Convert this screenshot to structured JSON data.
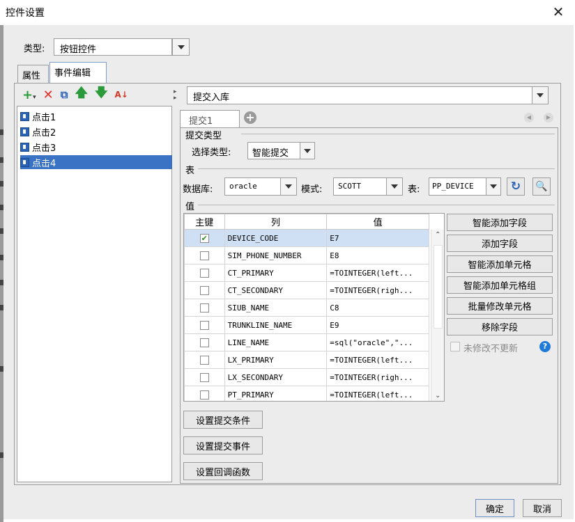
{
  "window": {
    "title": "控件设置"
  },
  "type_row": {
    "label": "类型:",
    "value": "按钮控件"
  },
  "tabs": [
    {
      "label": "属性"
    },
    {
      "label": "事件编辑"
    }
  ],
  "event_tree": {
    "items": [
      {
        "label": "点击1"
      },
      {
        "label": "点击2"
      },
      {
        "label": "点击3"
      },
      {
        "label": "点击4"
      }
    ]
  },
  "action": {
    "value": "提交入库"
  },
  "sub_tabs": [
    {
      "label": "提交1"
    }
  ],
  "submit_type": {
    "section": "提交类型",
    "label": "选择类型:",
    "value": "智能提交"
  },
  "table_section": {
    "section": "表",
    "db_label": "数据库:",
    "db_value": "oracle",
    "mode_label": "模式:",
    "mode_value": "SCOTT",
    "table_label": "表:",
    "table_value": "PP_DEVICE"
  },
  "values_section": {
    "section": "值",
    "headers": {
      "key": "主键",
      "col": "列",
      "val": "值"
    },
    "rows": [
      {
        "checked": true,
        "col": "DEVICE_CODE",
        "val": "E7"
      },
      {
        "checked": false,
        "col": "SIM_PHONE_NUMBER",
        "val": "E8"
      },
      {
        "checked": false,
        "col": "CT_PRIMARY",
        "val": "=TOINTEGER(left..."
      },
      {
        "checked": false,
        "col": "CT_SECONDARY",
        "val": "=TOINTEGER(righ..."
      },
      {
        "checked": false,
        "col": "SIUB_NAME",
        "val": "C8"
      },
      {
        "checked": false,
        "col": "TRUNKLINE_NAME",
        "val": "E9"
      },
      {
        "checked": false,
        "col": "LINE_NAME",
        "val": "=sql(\"oracle\",\"..."
      },
      {
        "checked": false,
        "col": "LX_PRIMARY",
        "val": "=TOINTEGER(left..."
      },
      {
        "checked": false,
        "col": "LX_SECONDARY",
        "val": "=TOINTEGER(righ..."
      },
      {
        "checked": false,
        "col": "PT_PRIMARY",
        "val": "=TOINTEGER(left..."
      }
    ],
    "side_buttons": [
      {
        "label": "智能添加字段"
      },
      {
        "label": "添加字段"
      },
      {
        "label": "智能添加单元格"
      },
      {
        "label": "智能添加单元格组"
      },
      {
        "label": "批量修改单元格"
      },
      {
        "label": "移除字段"
      }
    ],
    "no_update_label": "未修改不更新"
  },
  "bottom_buttons": [
    {
      "label": "设置提交条件"
    },
    {
      "label": "设置提交事件"
    },
    {
      "label": "设置回调函数"
    }
  ],
  "footer": {
    "ok": "确定",
    "cancel": "取消"
  },
  "colors": {
    "selected": "#3b73c4",
    "add": "#2a9a3a",
    "delete": "#e0302a",
    "help": "#1f7ad8"
  }
}
